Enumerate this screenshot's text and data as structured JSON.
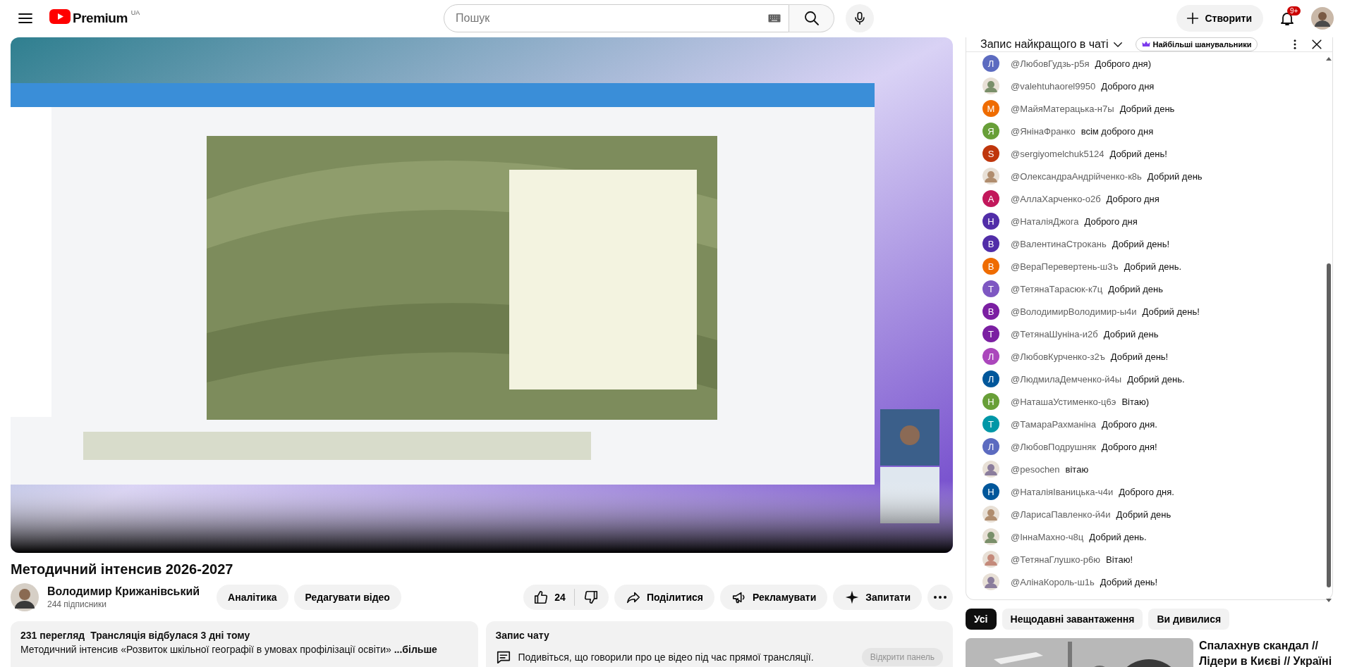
{
  "masthead": {
    "logo_text": "Premium",
    "region": "UA",
    "search_placeholder": "Пошук",
    "create": "Створити",
    "notifications": "9+"
  },
  "video": {
    "title": "Методичний інтенсив 2026-2027"
  },
  "channel": {
    "name": "Володимир Крижанівський",
    "subscribers": "244 підписники",
    "buttons": [
      "Аналітика",
      "Редагувати відео"
    ]
  },
  "actions": {
    "likes": "24",
    "buttons": [
      {
        "kind": "share",
        "label": "Поділитися"
      },
      {
        "kind": "promote",
        "label": "Рекламувати"
      },
      {
        "kind": "ask",
        "label": "Запитати"
      }
    ]
  },
  "description": {
    "views": "231 перегляд",
    "date": "Трансляція відбулася 3 дні тому",
    "text": "Методичний інтенсив «Розвиток шкільної географії в умовах профілізації освіти» **...більше**"
  },
  "chat_replay": {
    "title": "Запис чату",
    "text": "Подивіться, що говорили про це відео під час прямої трансляції.",
    "button": "Відкрити панель"
  },
  "chat": {
    "title": "Запис найкращого в чаті",
    "filter": "Найбільші шанувальники",
    "messages": [
      {
        "author": "@ЛюбовГудзь-р5я",
        "text": "Доброго дня)",
        "avatar": {
          "kind": "letter",
          "letter": "Л",
          "color": "#5c6bc0"
        }
      },
      {
        "author": "@valehtuhaorel9950",
        "text": "Доброго дня"
      },
      {
        "author": "@МайяМатерацька-н7ы",
        "text": "Добрий день",
        "avatar": {
          "kind": "letter",
          "letter": "М",
          "color": "#ef6c00"
        }
      },
      {
        "author": "@ЯнінаФранко",
        "text": "всім доброго дня",
        "avatar": {
          "kind": "letter",
          "letter": "Я",
          "color": "#689f38"
        }
      },
      {
        "author": "@sergiyomelchuk5124",
        "text": "Добрий день!",
        "avatar": {
          "kind": "letter",
          "letter": "S",
          "color": "#bf360c"
        }
      },
      {
        "author": "@ОлександраАндрійченко-к8ь",
        "text": "Добрий день"
      },
      {
        "author": "@АллаХарченко-о2б",
        "text": "Доброго дня",
        "avatar": {
          "kind": "letter",
          "letter": "А",
          "color": "#c2185b"
        }
      },
      {
        "author": "@НаталіяДжога",
        "text": "Доброго дня",
        "avatar": {
          "kind": "letter",
          "letter": "Н",
          "color": "#512da8"
        }
      },
      {
        "author": "@ВалентинаСтрокань",
        "text": "Добрий день!",
        "avatar": {
          "kind": "letter",
          "letter": "В",
          "color": "#512da8"
        }
      },
      {
        "author": "@ВераПеревертень-ш3ъ",
        "text": "Добрий день.",
        "avatar": {
          "kind": "letter",
          "letter": "В",
          "color": "#ef6c00"
        }
      },
      {
        "author": "@ТетянаТарасюк-к7ц",
        "text": "Добрий день",
        "avatar": {
          "kind": "letter",
          "letter": "Т",
          "color": "#7e57c2"
        }
      },
      {
        "author": "@ВолодимирВолодимир-ы4и",
        "text": "Добрий день!",
        "avatar": {
          "kind": "letter",
          "letter": "В",
          "color": "#7b1fa2"
        }
      },
      {
        "author": "@ТетянаШуніна-и2б",
        "text": "Добрий день",
        "avatar": {
          "kind": "letter",
          "letter": "Т",
          "color": "#7b1fa2"
        }
      },
      {
        "author": "@ЛюбовКурченко-з2ъ",
        "text": "Добрий день!",
        "avatar": {
          "kind": "letter",
          "letter": "Л",
          "color": "#ab47bc"
        }
      },
      {
        "author": "@ЛюдмилаДемченко-й4ы",
        "text": "Добрий день.",
        "avatar": {
          "kind": "letter",
          "letter": "Л",
          "color": "#01579b"
        }
      },
      {
        "author": "@НаташаУстименко-ц6э",
        "text": "Вітаю)",
        "avatar": {
          "kind": "letter",
          "letter": "Н",
          "color": "#689f38"
        }
      },
      {
        "author": "@ТамараРахманіна",
        "text": "Доброго дня.",
        "avatar": {
          "kind": "letter",
          "letter": "Т",
          "color": "#0097a7"
        }
      },
      {
        "author": "@ЛюбовПодрушняк",
        "text": "Доброго дня!",
        "avatar": {
          "kind": "letter",
          "letter": "Л",
          "color": "#5c6bc0"
        }
      },
      {
        "author": "@pesochen",
        "text": "вітаю"
      },
      {
        "author": "@НаталіяІваницька-ч4и",
        "text": "Доброго дня.",
        "avatar": {
          "kind": "letter",
          "letter": "Н",
          "color": "#01579b"
        }
      },
      {
        "author": "@ЛарисаПавленко-й4и",
        "text": "Добрий день"
      },
      {
        "author": "@ІннаМахно-ч8ц",
        "text": "Добрий день."
      },
      {
        "author": "@ТетянаГлушко-р6ю",
        "text": "Вітаю!"
      },
      {
        "author": "@АлінаКороль-ш1ь",
        "text": "Добрий день!"
      }
    ]
  },
  "chips": [
    {
      "label": "Усі",
      "selected": true
    },
    {
      "label": "Нещодавні завантаження",
      "selected": false
    },
    {
      "label": "Ви дивилися",
      "selected": false
    }
  ],
  "recommended": [
    {
      "title": "Спалахнув скандал // Лідери в Києві // Україні"
    }
  ]
}
